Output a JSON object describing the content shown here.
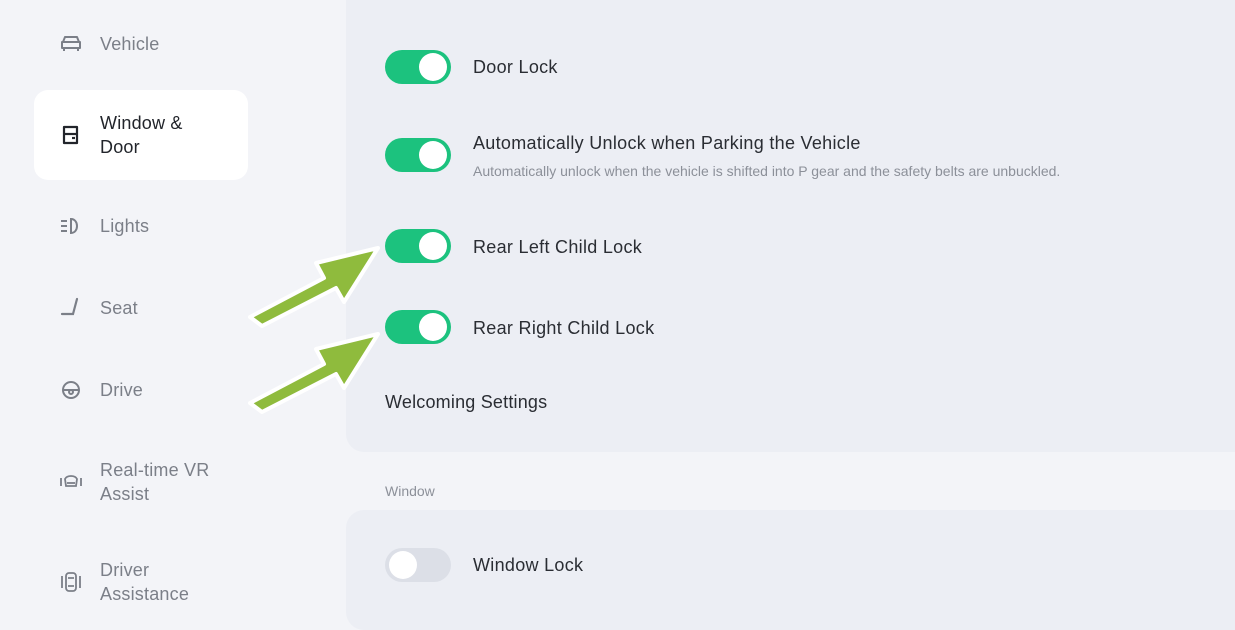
{
  "sidebar": {
    "items": [
      {
        "label": "Vehicle",
        "icon": "car-icon"
      },
      {
        "label_line1": "Window &",
        "label_line2": "Door",
        "icon": "door-icon",
        "active": true
      },
      {
        "label": "Lights",
        "icon": "headlight-icon"
      },
      {
        "label": "Seat",
        "icon": "seat-icon"
      },
      {
        "label": "Drive",
        "icon": "steering-wheel-icon"
      },
      {
        "label_line1": "Real-time VR",
        "label_line2": "Assist",
        "icon": "vr-assist-icon"
      },
      {
        "label_line1": "Driver",
        "label_line2": "Assistance",
        "icon": "driver-assistance-icon"
      }
    ]
  },
  "settings": {
    "door_lock": {
      "label": "Door Lock",
      "enabled": true
    },
    "auto_unlock": {
      "label": "Automatically Unlock when Parking the Vehicle",
      "description": "Automatically unlock  when the vehicle is shifted into P gear and the safety belts are unbuckled.",
      "enabled": true
    },
    "rear_left_child_lock": {
      "label": "Rear Left Child Lock",
      "enabled": true
    },
    "rear_right_child_lock": {
      "label": "Rear Right Child Lock",
      "enabled": true
    },
    "welcoming_settings": {
      "label": "Welcoming Settings"
    },
    "window_section": {
      "label": "Window"
    },
    "window_lock": {
      "label": "Window Lock",
      "enabled": false
    }
  },
  "colors": {
    "toggle_on": "#1cc27e",
    "toggle_off": "#dcdfe7",
    "annotation_arrow": "#8fbb3d"
  }
}
